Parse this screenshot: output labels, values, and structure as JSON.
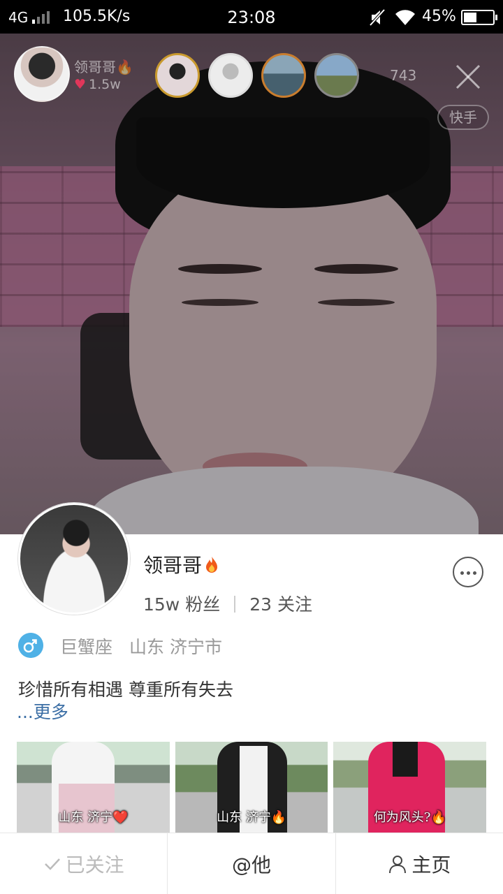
{
  "status_bar": {
    "network": "4G",
    "speed": "105.5K/s",
    "time": "23:08",
    "battery": "45%"
  },
  "live": {
    "host_name": "领哥哥",
    "host_likes": "1.5w",
    "viewer_count": "743",
    "platform_tag": "快手"
  },
  "profile": {
    "name": "领哥哥",
    "fans": "15w 粉丝",
    "following": "23 关注",
    "zodiac": "巨蟹座",
    "location": "山东 济宁市",
    "bio": "珍惜所有相遇 尊重所有失去",
    "more_link": "...更多",
    "thumbnails": [
      {
        "caption": "山东 济宁❤️"
      },
      {
        "caption": "山东 济宁🔥"
      },
      {
        "caption": "何为风头?🔥"
      }
    ]
  },
  "actions": {
    "followed": "已关注",
    "mention": "@他",
    "homepage": "主页"
  },
  "colors": {
    "link": "#3b6ea5",
    "gender_badge": "#4fb1e6",
    "heart": "#e0365a",
    "fire": "#f05a1a"
  }
}
